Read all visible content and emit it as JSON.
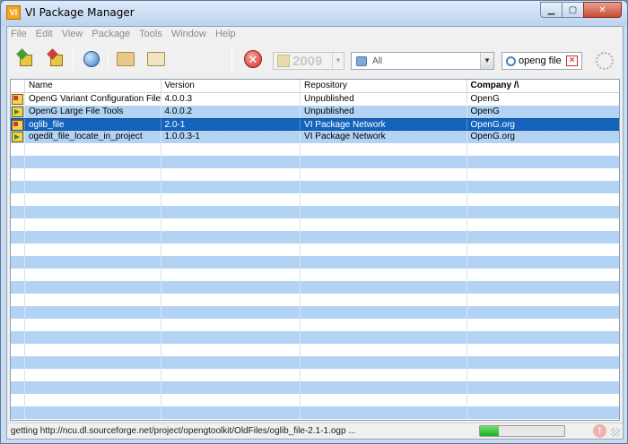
{
  "window": {
    "title": "VI Package Manager",
    "logo_text": "VI",
    "buttons": {
      "minimize": "▁",
      "maximize": "▢",
      "close": "✕"
    }
  },
  "menu": [
    "File",
    "Edit",
    "View",
    "Package",
    "Tools",
    "Window",
    "Help"
  ],
  "toolbar": {
    "labview_version": "2009",
    "filter_value": "All",
    "search_value": "openg file",
    "icons": [
      "install-package-icon",
      "uninstall-package-icon",
      "check-network-icon",
      "package-builder-icon",
      "package-configuration-icon",
      "stop-icon",
      "busy-spinner-icon"
    ]
  },
  "grid": {
    "columns": [
      "",
      "Name",
      "Version",
      "Repository",
      "Company  /\\"
    ],
    "sorted_column": "Company",
    "rows": [
      {
        "icon": "red",
        "name": "OpenG Variant Configuration File Tools",
        "version": "4.0.0.3",
        "repository": "Unpublished",
        "company": "OpenG"
      },
      {
        "icon": "green",
        "name": "OpenG Large File Tools",
        "version": "4.0.0.2",
        "repository": "Unpublished",
        "company": "OpenG"
      },
      {
        "icon": "red",
        "name": "oglib_file",
        "version": "2.0-1",
        "repository": "VI Package Network",
        "company": "OpenG.org",
        "selected": true
      },
      {
        "icon": "green",
        "name": "ogedit_file_locate_in_project",
        "version": "1.0.0.3-1",
        "repository": "VI Package Network",
        "company": "OpenG.org"
      }
    ]
  },
  "status": {
    "text": "getting http://ncu.dl.sourceforge.net/project/opengtoolkit/OldFiles/oglib_file-2.1-1.ogp ...",
    "progress": 0.22
  }
}
